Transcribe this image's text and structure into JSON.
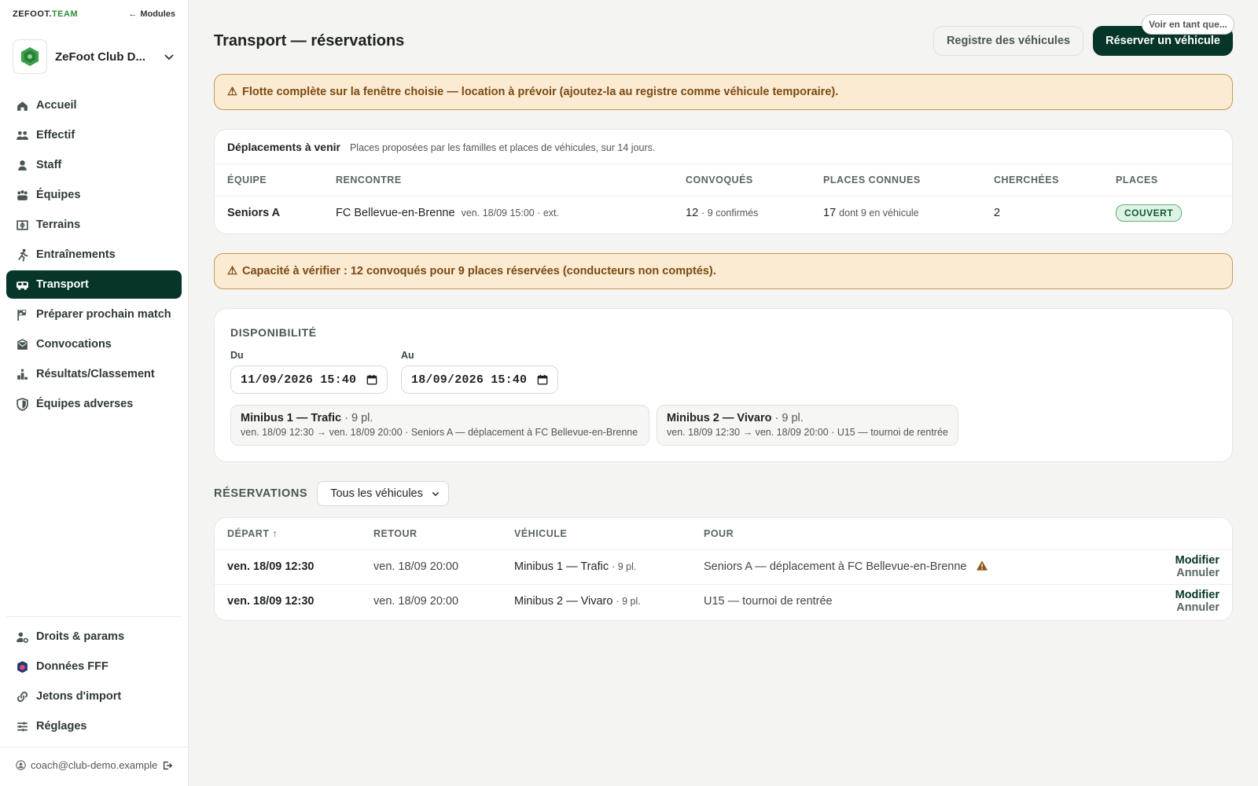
{
  "brand": {
    "prefix": "ZEFOOT.",
    "suffix": "TEAM",
    "modules_link": "Modules"
  },
  "club": {
    "name": "ZeFoot Club D..."
  },
  "nav": {
    "items": [
      {
        "label": "Accueil",
        "icon": "home-icon"
      },
      {
        "label": "Effectif",
        "icon": "people-icon"
      },
      {
        "label": "Staff",
        "icon": "person-icon"
      },
      {
        "label": "Équipes",
        "icon": "team-icon"
      },
      {
        "label": "Terrains",
        "icon": "field-icon"
      },
      {
        "label": "Entraînements",
        "icon": "running-icon"
      },
      {
        "label": "Transport",
        "icon": "bus-icon",
        "active": true
      },
      {
        "label": "Préparer prochain match",
        "icon": "flag-icon"
      },
      {
        "label": "Convocations",
        "icon": "envelope-icon"
      },
      {
        "label": "Résultats/Classement",
        "icon": "chart-icon"
      },
      {
        "label": "Équipes adverses",
        "icon": "shield-icon"
      }
    ],
    "bottom": [
      {
        "label": "Droits & params",
        "icon": "user-cog-icon"
      },
      {
        "label": "Données FFF",
        "icon": "fff-icon"
      },
      {
        "label": "Jetons d'import",
        "icon": "link-icon"
      },
      {
        "label": "Réglages",
        "icon": "sliders-icon"
      }
    ]
  },
  "user": {
    "email": "coach@club-demo.example"
  },
  "view_as": "Voir en tant que...",
  "header": {
    "title": "Transport — réservations",
    "registry_button": "Registre des véhicules",
    "reserve_button": "Réserver un véhicule"
  },
  "alerts": {
    "fleet": "Flotte complète sur la fenêtre choisie — location à prévoir (ajoutez-la au registre comme véhicule temporaire).",
    "capacity": "Capacité à vérifier : 12 convoqués pour 9 places réservées (conducteurs non comptés)."
  },
  "trips": {
    "title": "Déplacements à venir",
    "subtitle": "Places proposées par les familles et places de véhicules, sur 14 jours.",
    "columns": [
      "ÉQUIPE",
      "RENCONTRE",
      "CONVOQUÉS",
      "PLACES CONNUES",
      "CHERCHÉES",
      "PLACES"
    ],
    "rows": [
      {
        "team": "Seniors A",
        "match": "FC Bellevue-en-Brenne",
        "match_meta": "ven. 18/09 15:00 · ext.",
        "convoques": "12",
        "convoques_meta": "· 9 confirmés",
        "places": "17",
        "places_meta": "dont 9 en véhicule",
        "cherchees": "2",
        "status": "COUVERT"
      }
    ]
  },
  "dispo": {
    "title": "DISPONIBILITÉ",
    "from_label": "Du",
    "from_value": "11/09/2026 15:40",
    "to_label": "Au",
    "to_value": "18/09/2026 15:40",
    "vehicles": [
      {
        "name": "Minibus 1 — Trafic",
        "seats": "· 9 pl.",
        "detail": "ven. 18/09 12:30 → ven. 18/09 20:00 · Seniors A — déplacement à FC Bellevue-en-Brenne"
      },
      {
        "name": "Minibus 2 — Vivaro",
        "seats": "· 9 pl.",
        "detail": "ven. 18/09 12:30 → ven. 18/09 20:00 · U15 — tournoi de rentrée"
      }
    ]
  },
  "reservations": {
    "title": "RÉSERVATIONS",
    "filter": "Tous les véhicules",
    "columns": [
      "DÉPART",
      "RETOUR",
      "VÉHICULE",
      "POUR"
    ],
    "rows": [
      {
        "depart": "ven. 18/09 12:30",
        "retour": "ven. 18/09 20:00",
        "vehicle": "Minibus 1 — Trafic",
        "seats": "· 9 pl.",
        "pour": "Seniors A — déplacement à FC Bellevue-en-Brenne",
        "warning": true,
        "edit": "Modifier",
        "cancel": "Annuler"
      },
      {
        "depart": "ven. 18/09 12:30",
        "retour": "ven. 18/09 20:00",
        "vehicle": "Minibus 2 — Vivaro",
        "seats": "· 9 pl.",
        "pour": "U15 — tournoi de rentrée",
        "warning": false,
        "edit": "Modifier",
        "cancel": "Annuler"
      }
    ]
  },
  "colors": {
    "primary": "#06352a",
    "alert_bg": "#fcebd3",
    "alert_text": "#7a4a12",
    "badge_bg": "#dff3e4",
    "brand_accent": "#2e8b3a"
  }
}
